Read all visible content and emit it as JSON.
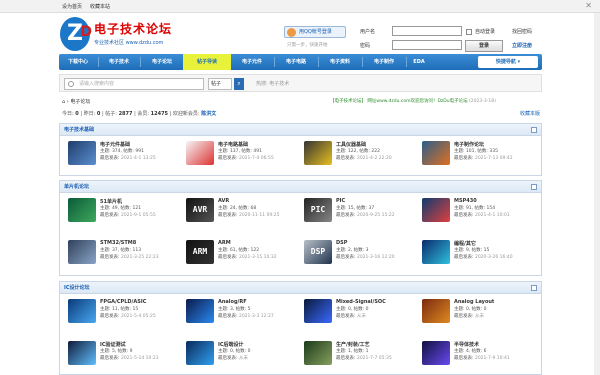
{
  "topbar": {
    "home": "设为首页",
    "fav": "收藏本站",
    "close": "✕"
  },
  "logo": {
    "title": "电子技术论坛",
    "sub": "专业技术社区 www.dzdu.com"
  },
  "login": {
    "qq_btn": "用QQ帐号登录",
    "qq_hint": "只需一步，快速开始",
    "user_label": "用户名",
    "pass_label": "密码",
    "remember": "自动登录",
    "find_pwd": "找回密码",
    "register": "立即注册",
    "login_btn": "登录",
    "user_placeholder": "",
    "pass_placeholder": ""
  },
  "nav": {
    "items": [
      "下载中心",
      "电子技术",
      "电子论坛",
      "帖子导读",
      "电子元件",
      "电子电路",
      "电子资料",
      "电子制作",
      "EDA"
    ],
    "active_index": 3,
    "more": "快捷导航 ▾"
  },
  "search": {
    "placeholder": "请输入搜索内容",
    "type": "帖子",
    "go": "⌕",
    "hot": "热搜: 电子技术"
  },
  "breadcrumb": {
    "home_icon": "home-icon",
    "sep": "›",
    "current": "电子论坛"
  },
  "announce": {
    "text": "【电子技术论坛】 网址www.dzdu.com欢迎您访问！DzDu电子论坛",
    "date": "(2023-3-18)"
  },
  "stats": {
    "today_label": "今日:",
    "today": "0",
    "yesterday_label": "昨日:",
    "yesterday": "0",
    "posts_label": "帖子:",
    "posts": "2877",
    "members_label": "会员:",
    "members": "12475",
    "newest_label": "欢迎新会员:",
    "newest": "陈洪文"
  },
  "fav_link": "收藏本版",
  "categories": [
    {
      "title": "电子技术基础",
      "forums": [
        {
          "name": "电子元件基础",
          "topics": "374",
          "posts": "991",
          "last": "2021-4-1 13:25",
          "icon": "components-icon"
        },
        {
          "name": "电子电路基础",
          "topics": "137",
          "posts": "491",
          "last": "2021-7-4 06:55",
          "icon": "circuit-icon"
        },
        {
          "name": "工具仪器基础",
          "topics": "122",
          "posts": "222",
          "last": "2021-4-2 22:20",
          "icon": "multimeter-icon"
        },
        {
          "name": "电子制作论坛",
          "topics": "101",
          "posts": "335",
          "last": "2021-7-13 09:42",
          "icon": "soldering-icon"
        }
      ]
    },
    {
      "title": "单片机论坛",
      "forums": [
        {
          "name": "51单片机",
          "topics": "49",
          "posts": "121",
          "last": "2021-9-1 05:55",
          "icon": "mcu51-icon"
        },
        {
          "name": "AVR",
          "topics": "24",
          "posts": "68",
          "last": "2020-11-11 09:25",
          "icon": "avr-icon"
        },
        {
          "name": "PIC",
          "topics": "15",
          "posts": "37",
          "last": "2020-9-25 15:22",
          "icon": "pic-icon"
        },
        {
          "name": "MSP430",
          "topics": "91",
          "posts": "154",
          "last": "2021-4-1 10:01",
          "icon": "msp430-icon"
        },
        {
          "name": "STM32/STM8",
          "topics": "37",
          "posts": "113",
          "last": "2021-3-25 22:23",
          "icon": "stm32-icon"
        },
        {
          "name": "ARM",
          "topics": "61",
          "posts": "122",
          "last": "2021-3-15 10:32",
          "icon": "arm-icon"
        },
        {
          "name": "DSP",
          "topics": "2",
          "posts": "3",
          "last": "2021-3-16 12:20",
          "icon": "dsp-icon"
        },
        {
          "name": "编程/其它",
          "topics": "9",
          "posts": "15",
          "last": "2020-3-26 16:40",
          "icon": "programming-icon"
        }
      ]
    },
    {
      "title": "IC设计论坛",
      "forums": [
        {
          "name": "FPGA/CPLD/ASIC",
          "topics": "11",
          "posts": "15",
          "last": "2021-5-4 05:25",
          "icon": "fpga-icon"
        },
        {
          "name": "Analog/RF",
          "topics": "3",
          "posts": "5",
          "last": "2021-3-3 12:27",
          "icon": "analog-icon"
        },
        {
          "name": "Mixed-Signal/SOC",
          "topics": "0",
          "posts": "0",
          "last": "从未",
          "icon": "mixed-signal-icon"
        },
        {
          "name": "Analog Layout",
          "topics": "0",
          "posts": "0",
          "last": "从未",
          "icon": "layout-icon"
        },
        {
          "name": "IC验证测试",
          "topics": "5",
          "posts": "9",
          "last": "2021-5-14 10:23",
          "icon": "ic-test-icon"
        },
        {
          "name": "IC后端设计",
          "topics": "0",
          "posts": "0",
          "last": "从未",
          "icon": "ic-backend-icon"
        },
        {
          "name": "生产/封装/工艺",
          "topics": "1",
          "posts": "1",
          "last": "2021-7-7 05:35",
          "icon": "packaging-icon"
        },
        {
          "name": "半导体技术",
          "topics": "4",
          "posts": "6",
          "last": "2021-7-9 10:41",
          "icon": "semiconductor-icon"
        }
      ]
    }
  ],
  "labels": {
    "topics": "主题:",
    "posts": "帖数:",
    "last": "最后发表:"
  }
}
